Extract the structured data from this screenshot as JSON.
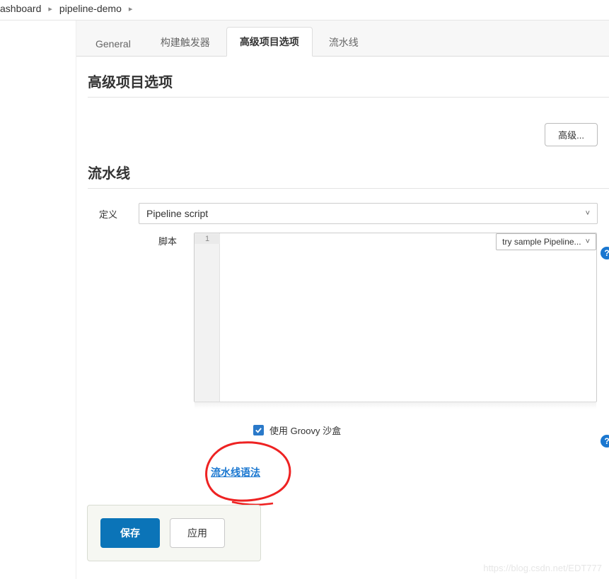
{
  "breadcrumb": {
    "item1": "ashboard",
    "item2": "pipeline-demo"
  },
  "tabs": {
    "general": "General",
    "triggers": "构建触发器",
    "advanced": "高级项目选项",
    "pipeline": "流水线"
  },
  "sections": {
    "advanced_title": "高级项目选项",
    "advanced_button": "高级...",
    "pipeline_title": "流水线"
  },
  "form": {
    "definition_label": "定义",
    "definition_value": "Pipeline script",
    "script_label": "脚本",
    "line_num": "1",
    "sample_dropdown": "try sample Pipeline..."
  },
  "sandbox": {
    "label": "使用 Groovy 沙盒"
  },
  "syntax_link": "流水线语法",
  "footer": {
    "save": "保存",
    "apply": "应用"
  },
  "help_text": "?",
  "watermark": "https://blog.csdn.net/EDT777"
}
